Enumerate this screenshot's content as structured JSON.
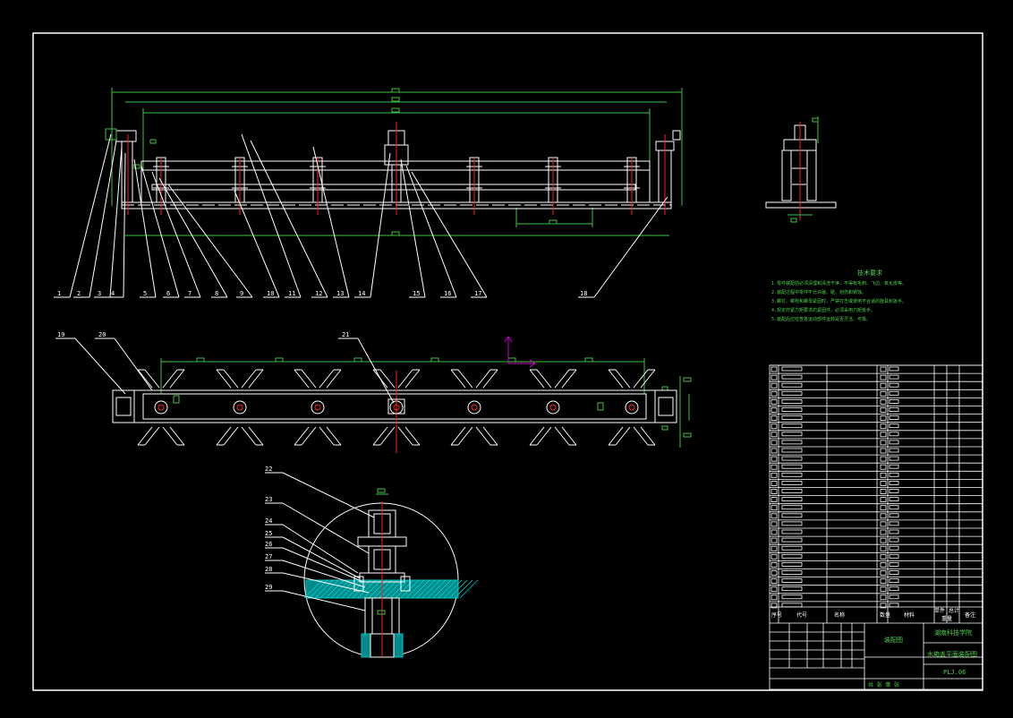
{
  "drawing": {
    "balloon_numbers": [
      "1",
      "2",
      "3",
      "4",
      "5",
      "6",
      "7",
      "8",
      "9",
      "10",
      "11",
      "12",
      "13",
      "14",
      "15",
      "16",
      "17",
      "18",
      "19",
      "20",
      "21",
      "22",
      "23",
      "24",
      "25",
      "26",
      "27",
      "28",
      "29"
    ],
    "tech_requirements": {
      "title": "技术要求",
      "lines": [
        "1.零件装配前必须清理和清洗干净，不得有毛刺、飞边、氧化皮等。",
        "2.装配过程中零件不允许磕、碰、划伤和锈蚀。",
        "3.螺钉、螺栓和螺母紧固时，严禁打击或使用不合适的旋具和扳手。",
        "4.规定拧紧力矩要求的紧固件，必须采用力矩扳手。",
        "5.装配后应检查各运动部件运转是否灵活、可靠。"
      ]
    },
    "title_block": {
      "header": {
        "seq": "序号",
        "code": "代号",
        "name": "名称",
        "qty": "数量",
        "material": "材料",
        "unit_weight": "单件",
        "total_weight": "总计",
        "weight": "重量",
        "remark": "备注"
      },
      "drawing_name": "装配图",
      "school": "湖南科技学院",
      "product": "水箱盖平面装配图",
      "drawing_no": "PLJ.06",
      "scale_row": "共 张  第 张"
    },
    "colors": {
      "outline": "#ffffff",
      "dim": "#3fbf3f",
      "center": "#ff2020",
      "hatch": "#00c8c8",
      "accent": "#d000d0"
    }
  }
}
